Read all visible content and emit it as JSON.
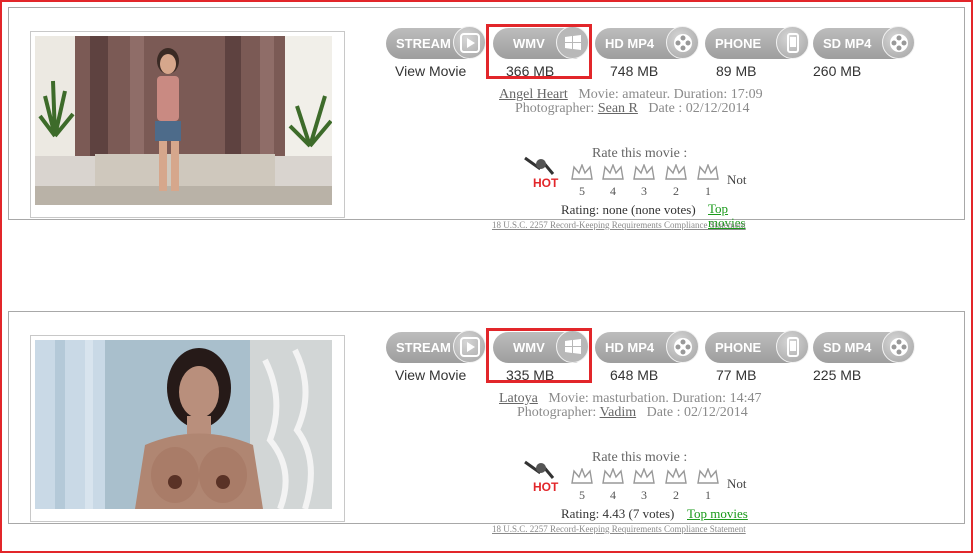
{
  "colors": {
    "frame": "#e2262a",
    "button": "#a6a6a6",
    "link_green": "#1a9a1a"
  },
  "buttons": {
    "stream": "STREAM",
    "wmv": "WMV",
    "hd_mp4": "HD MP4",
    "phone": "PHONE",
    "sd_mp4": "SD MP4"
  },
  "icons": {
    "stream": "play-icon",
    "wmv": "windows-icon",
    "hd_mp4": "film-reel-icon",
    "phone": "phone-icon",
    "sd_mp4": "film-reel-icon"
  },
  "movies": [
    {
      "view_label": "View Movie",
      "sizes": {
        "wmv": "366 MB",
        "hd_mp4": "748 MB",
        "phone": "89 MB",
        "sd_mp4": "260 MB"
      },
      "model": "Angel Heart",
      "movie_line": "Movie: amateur. Duration: 17:09",
      "photographer_label": "Photographer:",
      "photographer": "Sean R",
      "date_line": "Date : 02/12/2014",
      "rate_title": "Rate this movie :",
      "hot": "HOT",
      "crowns": [
        "5",
        "4",
        "3",
        "2",
        "1"
      ],
      "not_label": "Not",
      "rating_text": "Rating: none   (none votes)",
      "top_movies": "Top movies",
      "legal": "18 U.S.C. 2257 Record-Keeping Requirements Compliance Statement"
    },
    {
      "view_label": "View Movie",
      "sizes": {
        "wmv": "335 MB",
        "hd_mp4": "648 MB",
        "phone": "77 MB",
        "sd_mp4": "225 MB"
      },
      "model": "Latoya",
      "movie_line": "Movie: masturbation. Duration: 14:47",
      "photographer_label": "Photographer:",
      "photographer": "Vadim",
      "date_line": "Date : 02/12/2014",
      "rate_title": "Rate this movie :",
      "hot": "HOT",
      "crowns": [
        "5",
        "4",
        "3",
        "2",
        "1"
      ],
      "not_label": "Not",
      "rating_text": "Rating: 4.43   (7 votes)",
      "top_movies": "Top movies",
      "legal": "18 U.S.C. 2257 Record-Keeping Requirements Compliance Statement"
    }
  ]
}
